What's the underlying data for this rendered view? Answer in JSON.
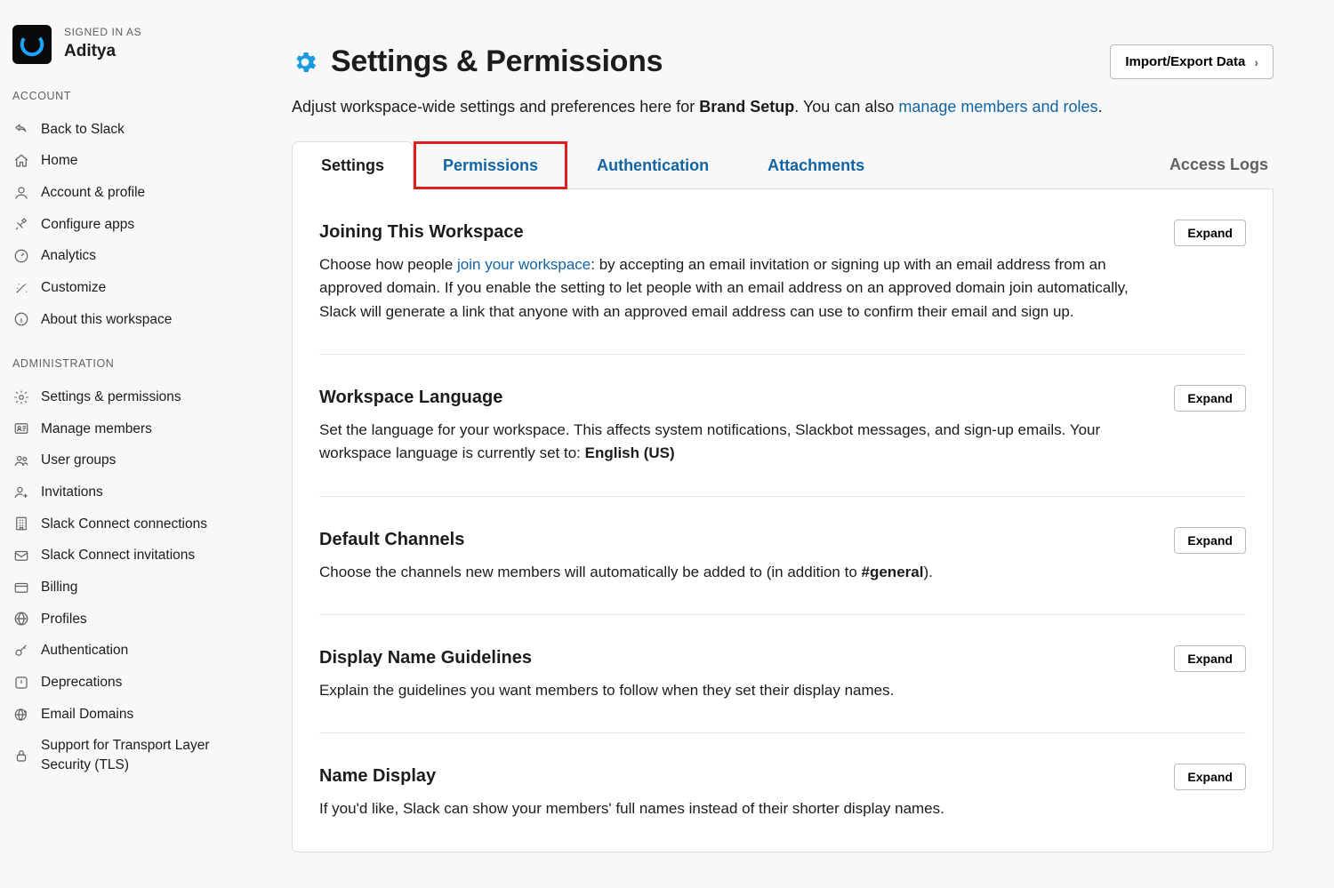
{
  "sidebar": {
    "signed_in_label": "SIGNED IN AS",
    "user_name": "Aditya",
    "account_header": "ACCOUNT",
    "admin_header": "ADMINISTRATION",
    "account_items": [
      {
        "label": "Back to Slack"
      },
      {
        "label": "Home"
      },
      {
        "label": "Account & profile"
      },
      {
        "label": "Configure apps"
      },
      {
        "label": "Analytics"
      },
      {
        "label": "Customize"
      },
      {
        "label": "About this workspace"
      }
    ],
    "admin_items": [
      {
        "label": "Settings & permissions"
      },
      {
        "label": "Manage members"
      },
      {
        "label": "User groups"
      },
      {
        "label": "Invitations"
      },
      {
        "label": "Slack Connect connections"
      },
      {
        "label": "Slack Connect invitations"
      },
      {
        "label": "Billing"
      },
      {
        "label": "Profiles"
      },
      {
        "label": "Authentication"
      },
      {
        "label": "Deprecations"
      },
      {
        "label": "Email Domains"
      },
      {
        "label": "Support for Transport Layer Security (TLS)"
      }
    ]
  },
  "header": {
    "title": "Settings & Permissions",
    "import_button": "Import/Export Data",
    "subtitle_prefix": "Adjust workspace-wide settings and preferences here for ",
    "subtitle_bold": "Brand Setup",
    "subtitle_middle": ". You can also ",
    "subtitle_link": "manage members and roles",
    "subtitle_suffix": "."
  },
  "tabs": {
    "settings": "Settings",
    "permissions": "Permissions",
    "authentication": "Authentication",
    "attachments": "Attachments",
    "access_logs": "Access Logs"
  },
  "sections": [
    {
      "title": "Joining This Workspace",
      "desc_prefix": "Choose how people ",
      "desc_link": "join your workspace",
      "desc_suffix": ": by accepting an email invitation or signing up with an email address from an approved domain. If you enable the setting to let people with an email address on an approved domain join automatically, Slack will generate a link that anyone with an approved email address can use to confirm their email and sign up.",
      "expand": "Expand"
    },
    {
      "title": "Workspace Language",
      "desc_prefix": "Set the language for your workspace. This affects system notifications, Slackbot messages, and sign-up emails. Your workspace language is currently set to: ",
      "desc_bold": "English (US)",
      "expand": "Expand"
    },
    {
      "title": "Default Channels",
      "desc_prefix": "Choose the channels new members will automatically be added to (in addition to ",
      "desc_bold": "#general",
      "desc_suffix": ").",
      "expand": "Expand"
    },
    {
      "title": "Display Name Guidelines",
      "desc_prefix": "Explain the guidelines you want members to follow when they set their display names.",
      "expand": "Expand"
    },
    {
      "title": "Name Display",
      "desc_prefix": "If you'd like, Slack can show your members' full names instead of their shorter display names.",
      "expand": "Expand"
    }
  ]
}
